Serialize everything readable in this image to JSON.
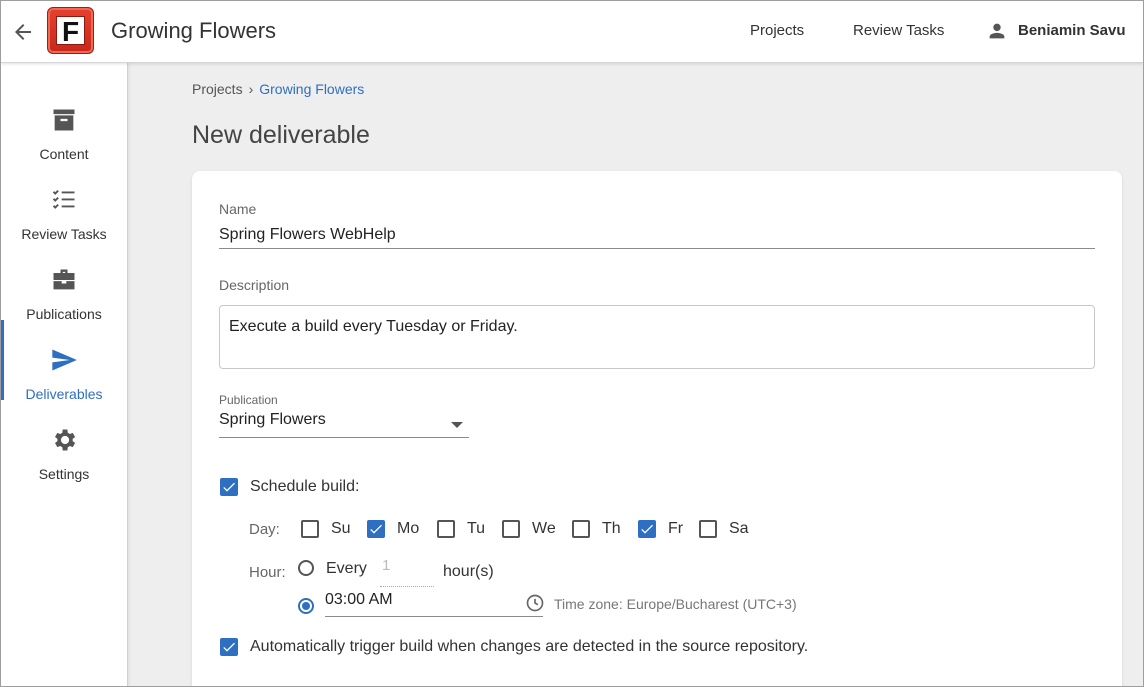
{
  "header": {
    "app_title": "Growing Flowers",
    "logo_letter": "F",
    "nav": {
      "projects": "Projects",
      "review_tasks": "Review Tasks"
    },
    "user_name": "Beniamin Savu"
  },
  "sidebar": {
    "items": [
      {
        "label": "Content",
        "icon": "archive-icon",
        "active": false
      },
      {
        "label": "Review Tasks",
        "icon": "checklist-icon",
        "active": false
      },
      {
        "label": "Publications",
        "icon": "briefcase-icon",
        "active": false
      },
      {
        "label": "Deliverables",
        "icon": "send-icon",
        "active": true
      },
      {
        "label": "Settings",
        "icon": "gear-icon",
        "active": false
      }
    ]
  },
  "breadcrumb": {
    "root": "Projects",
    "current": "Growing Flowers"
  },
  "page_title": "New deliverable",
  "form": {
    "name_label": "Name",
    "name_value": "Spring Flowers WebHelp",
    "description_label": "Description",
    "description_value": "Execute a build every Tuesday or Friday.",
    "publication_label": "Publication",
    "publication_value": "Spring Flowers",
    "schedule_label": "Schedule build:",
    "schedule_checked": true,
    "day_label": "Day:",
    "days": [
      {
        "label": "Su",
        "checked": false
      },
      {
        "label": "Mo",
        "checked": true
      },
      {
        "label": "Tu",
        "checked": false
      },
      {
        "label": "We",
        "checked": false
      },
      {
        "label": "Th",
        "checked": false
      },
      {
        "label": "Fr",
        "checked": true
      },
      {
        "label": "Sa",
        "checked": false
      }
    ],
    "hour_label": "Hour:",
    "every_label": "Every",
    "every_value": "1",
    "hours_unit": "hour(s)",
    "time_value": "03:00 AM",
    "time_zone": "Time zone: Europe/Bucharest (UTC+3)",
    "auto_trigger_label": "Automatically trigger build when changes are detected in the source repository.",
    "auto_trigger_checked": true
  },
  "colors": {
    "accent": "#2e6fc1",
    "logo_red": "#d9321f"
  }
}
